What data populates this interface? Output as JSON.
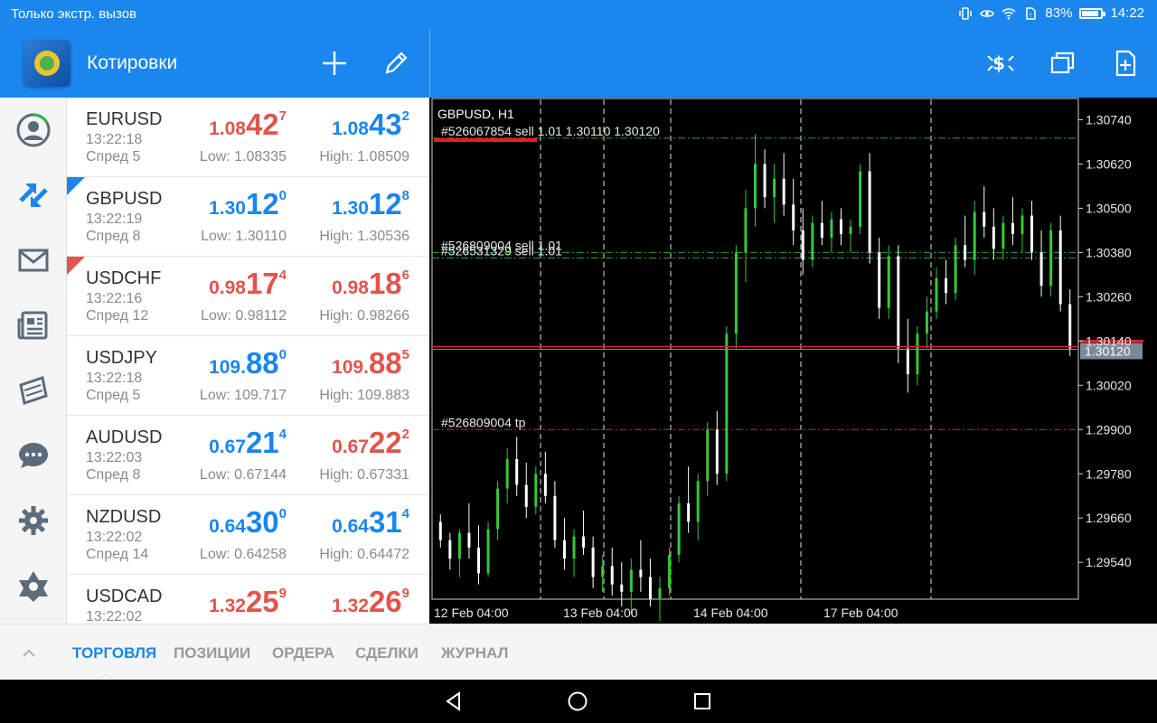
{
  "status": {
    "left_text": "Только экстр. вызов",
    "battery": "83%",
    "time": "14:22"
  },
  "appbar": {
    "title": "Котировки",
    "icons": [
      "add-icon",
      "edit-icon",
      "trade-icon",
      "windows-icon",
      "new-document-icon"
    ]
  },
  "nav": [
    "account-icon",
    "trade-icon",
    "mail-icon",
    "news-icon",
    "calendar-icon",
    "chat-icon",
    "settings-icon",
    "community-icon"
  ],
  "quotes": [
    {
      "symbol": "EURUSD",
      "time": "13:22:18",
      "spread": "Спред 5",
      "bid": {
        "pfx": "1.08",
        "big": "42",
        "sup": "7",
        "color": "red"
      },
      "ask": {
        "pfx": "1.08",
        "big": "43",
        "sup": "2",
        "color": "blue"
      },
      "low": "Low: 1.08335",
      "high": "High: 1.08509",
      "corner": ""
    },
    {
      "symbol": "GBPUSD",
      "time": "13:22:19",
      "spread": "Спред 8",
      "bid": {
        "pfx": "1.30",
        "big": "12",
        "sup": "0",
        "color": "blue"
      },
      "ask": {
        "pfx": "1.30",
        "big": "12",
        "sup": "8",
        "color": "blue"
      },
      "low": "Low: 1.30110",
      "high": "High: 1.30536",
      "corner": "blue"
    },
    {
      "symbol": "USDCHF",
      "time": "13:22:16",
      "spread": "Спред 12",
      "bid": {
        "pfx": "0.98",
        "big": "17",
        "sup": "4",
        "color": "red"
      },
      "ask": {
        "pfx": "0.98",
        "big": "18",
        "sup": "6",
        "color": "red"
      },
      "low": "Low: 0.98112",
      "high": "High: 0.98266",
      "corner": "red"
    },
    {
      "symbol": "USDJPY",
      "time": "13:22:18",
      "spread": "Спред 5",
      "bid": {
        "pfx": "109.",
        "big": "88",
        "sup": "0",
        "color": "blue"
      },
      "ask": {
        "pfx": "109.",
        "big": "88",
        "sup": "5",
        "color": "red"
      },
      "low": "Low: 109.717",
      "high": "High: 109.883",
      "corner": ""
    },
    {
      "symbol": "AUDUSD",
      "time": "13:22:03",
      "spread": "Спред 8",
      "bid": {
        "pfx": "0.67",
        "big": "21",
        "sup": "4",
        "color": "blue"
      },
      "ask": {
        "pfx": "0.67",
        "big": "22",
        "sup": "2",
        "color": "red"
      },
      "low": "Low: 0.67144",
      "high": "High: 0.67331",
      "corner": ""
    },
    {
      "symbol": "NZDUSD",
      "time": "13:22:02",
      "spread": "Спред 14",
      "bid": {
        "pfx": "0.64",
        "big": "30",
        "sup": "0",
        "color": "blue"
      },
      "ask": {
        "pfx": "0.64",
        "big": "31",
        "sup": "4",
        "color": "blue"
      },
      "low": "Low: 0.64258",
      "high": "High: 0.64472",
      "corner": ""
    },
    {
      "symbol": "USDCAD",
      "time": "13:22:02",
      "spread": "",
      "bid": {
        "pfx": "1.32",
        "big": "25",
        "sup": "9",
        "color": "red"
      },
      "ask": {
        "pfx": "1.32",
        "big": "26",
        "sup": "9",
        "color": "red"
      },
      "low": "",
      "high": "",
      "corner": ""
    }
  ],
  "chart_data": {
    "type": "candlestick",
    "title": "GBPUSD, H1",
    "y_ticks": [
      "1.30740",
      "1.30620",
      "1.30500",
      "1.30380",
      "1.30260",
      "1.30140",
      "1.30020",
      "1.29900",
      "1.29780",
      "1.29660",
      "1.29540"
    ],
    "ylim": [
      1.2944,
      1.308
    ],
    "x_ticks": [
      "12 Feb 04:00",
      "13 Feb 04:00",
      "14 Feb 04:00",
      "17 Feb 04:00"
    ],
    "current_price": "1.30120",
    "current_price_value": 1.3012,
    "order_lines": [
      {
        "label": "#526067854 sell 1.01 1.30110 1.30120",
        "price": 1.3069,
        "color": "#2e9e2e",
        "style": "dashdot"
      },
      {
        "label": "#526809004 sell 1.01",
        "price": 1.3038,
        "color": "#2e9e2e",
        "style": "dashdot"
      },
      {
        "label": "#526531329 sell 1.01",
        "price": 1.30365,
        "color": "#2e9e2e",
        "style": "dashdot"
      },
      {
        "label": "#526809004 tp",
        "price": 1.299,
        "color": "#c03030",
        "style": "dashdot"
      }
    ],
    "candle_data": [
      [
        1.2965,
        1.2967,
        1.2958,
        1.296
      ],
      [
        1.296,
        1.2962,
        1.2952,
        1.2955
      ],
      [
        1.2955,
        1.2963,
        1.295,
        1.2962
      ],
      [
        1.2962,
        1.297,
        1.2955,
        1.2958
      ],
      [
        1.2958,
        1.2964,
        1.2948,
        1.2951
      ],
      [
        1.2951,
        1.2965,
        1.295,
        1.2963
      ],
      [
        1.2963,
        1.2976,
        1.296,
        1.2974
      ],
      [
        1.2974,
        1.2985,
        1.297,
        1.2982
      ],
      [
        1.2982,
        1.2988,
        1.2972,
        1.2975
      ],
      [
        1.2975,
        1.2981,
        1.2966,
        1.2969
      ],
      [
        1.2969,
        1.298,
        1.2967,
        1.2978
      ],
      [
        1.2978,
        1.2984,
        1.297,
        1.2972
      ],
      [
        1.2972,
        1.2976,
        1.2958,
        1.296
      ],
      [
        1.296,
        1.2966,
        1.2952,
        1.2955
      ],
      [
        1.2955,
        1.2963,
        1.295,
        1.2961
      ],
      [
        1.2961,
        1.2968,
        1.2956,
        1.2958
      ],
      [
        1.2958,
        1.2961,
        1.2947,
        1.295
      ],
      [
        1.295,
        1.2956,
        1.2946,
        1.2953
      ],
      [
        1.2953,
        1.2958,
        1.2945,
        1.2948
      ],
      [
        1.2948,
        1.2954,
        1.2942,
        1.2946
      ],
      [
        1.2946,
        1.2955,
        1.294,
        1.2952
      ],
      [
        1.2952,
        1.296,
        1.2946,
        1.295
      ],
      [
        1.295,
        1.2955,
        1.2942,
        1.2944
      ],
      [
        1.2944,
        1.295,
        1.2938,
        1.2947
      ],
      [
        1.2947,
        1.2958,
        1.2945,
        1.2956
      ],
      [
        1.2956,
        1.2972,
        1.2954,
        1.297
      ],
      [
        1.297,
        1.298,
        1.2962,
        1.2965
      ],
      [
        1.2965,
        1.2978,
        1.296,
        1.2976
      ],
      [
        1.2976,
        1.2992,
        1.2972,
        1.299
      ],
      [
        1.299,
        1.2995,
        1.2975,
        1.2978
      ],
      [
        1.2978,
        1.3018,
        1.2976,
        1.3016
      ],
      [
        1.3016,
        1.304,
        1.3012,
        1.3038
      ],
      [
        1.3038,
        1.3055,
        1.303,
        1.305
      ],
      [
        1.305,
        1.307,
        1.3045,
        1.3062
      ],
      [
        1.3062,
        1.3066,
        1.305,
        1.3053
      ],
      [
        1.3053,
        1.3062,
        1.3046,
        1.3058
      ],
      [
        1.3058,
        1.3065,
        1.3048,
        1.3051
      ],
      [
        1.3051,
        1.3058,
        1.304,
        1.3044
      ],
      [
        1.3044,
        1.305,
        1.3032,
        1.3036
      ],
      [
        1.3036,
        1.3048,
        1.3034,
        1.3046
      ],
      [
        1.3046,
        1.3052,
        1.304,
        1.3042
      ],
      [
        1.3042,
        1.3049,
        1.3038,
        1.3047
      ],
      [
        1.3047,
        1.305,
        1.304,
        1.3043
      ],
      [
        1.3043,
        1.3047,
        1.3038,
        1.3045
      ],
      [
        1.3045,
        1.3062,
        1.3043,
        1.306
      ],
      [
        1.306,
        1.3065,
        1.3035,
        1.3038
      ],
      [
        1.3038,
        1.3042,
        1.302,
        1.3023
      ],
      [
        1.3023,
        1.304,
        1.302,
        1.3037
      ],
      [
        1.3037,
        1.304,
        1.3008,
        1.3012
      ],
      [
        1.3012,
        1.302,
        1.3,
        1.3005
      ],
      [
        1.3005,
        1.3018,
        1.3002,
        1.3016
      ],
      [
        1.3016,
        1.3026,
        1.3012,
        1.3022
      ],
      [
        1.3022,
        1.3034,
        1.302,
        1.3031
      ],
      [
        1.3031,
        1.3036,
        1.3024,
        1.3027
      ],
      [
        1.3027,
        1.3042,
        1.3025,
        1.304
      ],
      [
        1.304,
        1.3048,
        1.3034,
        1.3036
      ],
      [
        1.3036,
        1.3052,
        1.3032,
        1.3049
      ],
      [
        1.3049,
        1.3056,
        1.3042,
        1.3045
      ],
      [
        1.3045,
        1.305,
        1.3036,
        1.3039
      ],
      [
        1.3039,
        1.3048,
        1.3036,
        1.3046
      ],
      [
        1.3046,
        1.3053,
        1.304,
        1.3043
      ],
      [
        1.3043,
        1.305,
        1.3038,
        1.3048
      ],
      [
        1.3048,
        1.3052,
        1.3036,
        1.3038
      ],
      [
        1.3038,
        1.3044,
        1.3026,
        1.3029
      ],
      [
        1.3029,
        1.3046,
        1.3026,
        1.3044
      ],
      [
        1.3044,
        1.3048,
        1.3022,
        1.3024
      ],
      [
        1.3024,
        1.3028,
        1.301,
        1.3012
      ]
    ]
  },
  "tabs": [
    "ТОРГОВЛЯ",
    "ПОЗИЦИИ",
    "ОРДЕРА",
    "СДЕЛКИ",
    "ЖУРНАЛ"
  ],
  "colors": {
    "brand": "#1a86ee",
    "down": "#e0554d",
    "up": "#1a86ee"
  }
}
